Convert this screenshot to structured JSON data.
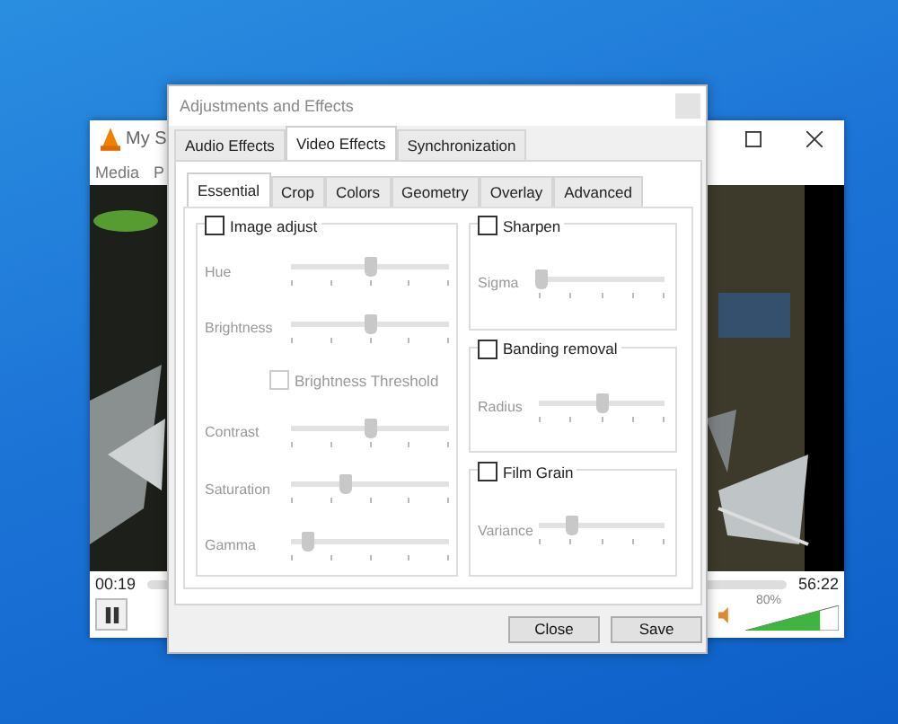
{
  "player": {
    "title": "My S",
    "menu": [
      "Media",
      "P"
    ],
    "video": {
      "kind": "picture"
    },
    "elapsed": "00:19",
    "total": "56:22",
    "volume": {
      "reading": "80%",
      "level": 0.8
    }
  },
  "dialog": {
    "title": "Adjustments and Effects",
    "tabs": [
      {
        "label": "Audio Effects",
        "selected": false
      },
      {
        "label": "Video Effects",
        "selected": true
      },
      {
        "label": "Synchronization",
        "selected": false
      }
    ],
    "subtabs": [
      {
        "label": "Essential",
        "selected": true
      },
      {
        "label": "Crop",
        "selected": false
      },
      {
        "label": "Colors",
        "selected": false
      },
      {
        "label": "Geometry",
        "selected": false
      },
      {
        "label": "Overlay",
        "selected": false
      },
      {
        "label": "Advanced",
        "selected": false
      }
    ],
    "image_adjust": {
      "label": "Image adjust",
      "checked": false,
      "rows": [
        {
          "kind": "slider",
          "label": "Hue",
          "level": 0.5
        },
        {
          "kind": "slider",
          "label": "Brightness",
          "level": 0.5
        },
        {
          "kind": "checkbox",
          "label": "Brightness Threshold",
          "checked": false,
          "disabled": true
        },
        {
          "kind": "slider",
          "label": "Contrast",
          "level": 0.5
        },
        {
          "kind": "slider",
          "label": "Saturation",
          "level": 0.34
        },
        {
          "kind": "slider",
          "label": "Gamma",
          "level": 0.1
        }
      ]
    },
    "groups": [
      {
        "label": "Sharpen",
        "checked": false,
        "slider": {
          "label": "Sigma",
          "level": 0.02
        }
      },
      {
        "label": "Banding removal",
        "checked": false,
        "slider": {
          "label": "Radius",
          "level": 0.5
        }
      },
      {
        "label": "Film Grain",
        "checked": false,
        "slider": {
          "label": "Variance",
          "level": 0.25
        }
      }
    ],
    "buttons": [
      "Close",
      "Save"
    ]
  }
}
